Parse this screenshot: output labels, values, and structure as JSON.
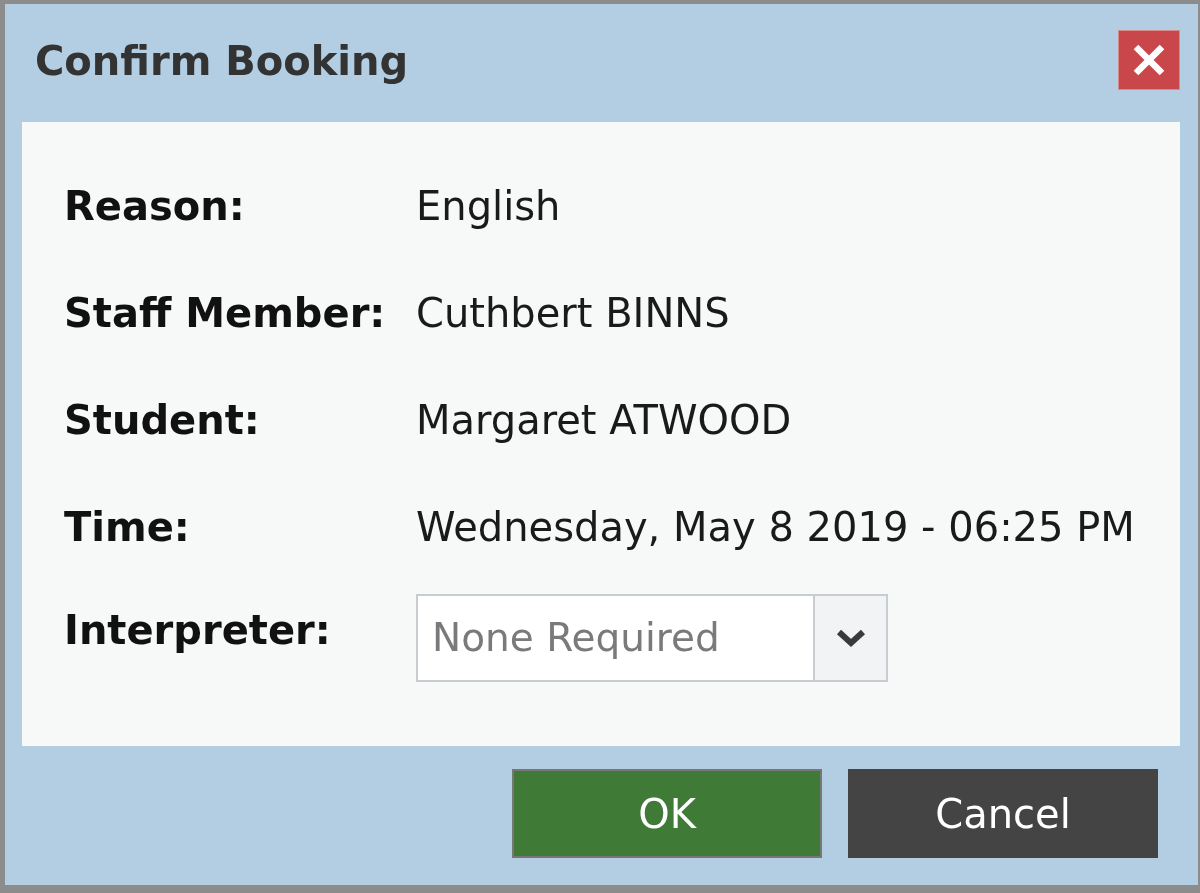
{
  "dialog": {
    "title": "Confirm Booking"
  },
  "fields": [
    {
      "kind": "text",
      "label": "Reason:",
      "value": "English"
    },
    {
      "kind": "text",
      "label": "Staff Member:",
      "value": "Cuthbert BINNS"
    },
    {
      "kind": "text",
      "label": "Student:",
      "value": "Margaret ATWOOD"
    },
    {
      "kind": "text",
      "label": "Time:",
      "value": "Wednesday, May 8 2019 - 06:25 PM"
    },
    {
      "kind": "dropdown",
      "label": "Interpreter:",
      "placeholder": "None Required"
    }
  ],
  "buttons": [
    {
      "kind": "primary",
      "label": "OK"
    },
    {
      "kind": "secondary",
      "label": "Cancel"
    }
  ]
}
